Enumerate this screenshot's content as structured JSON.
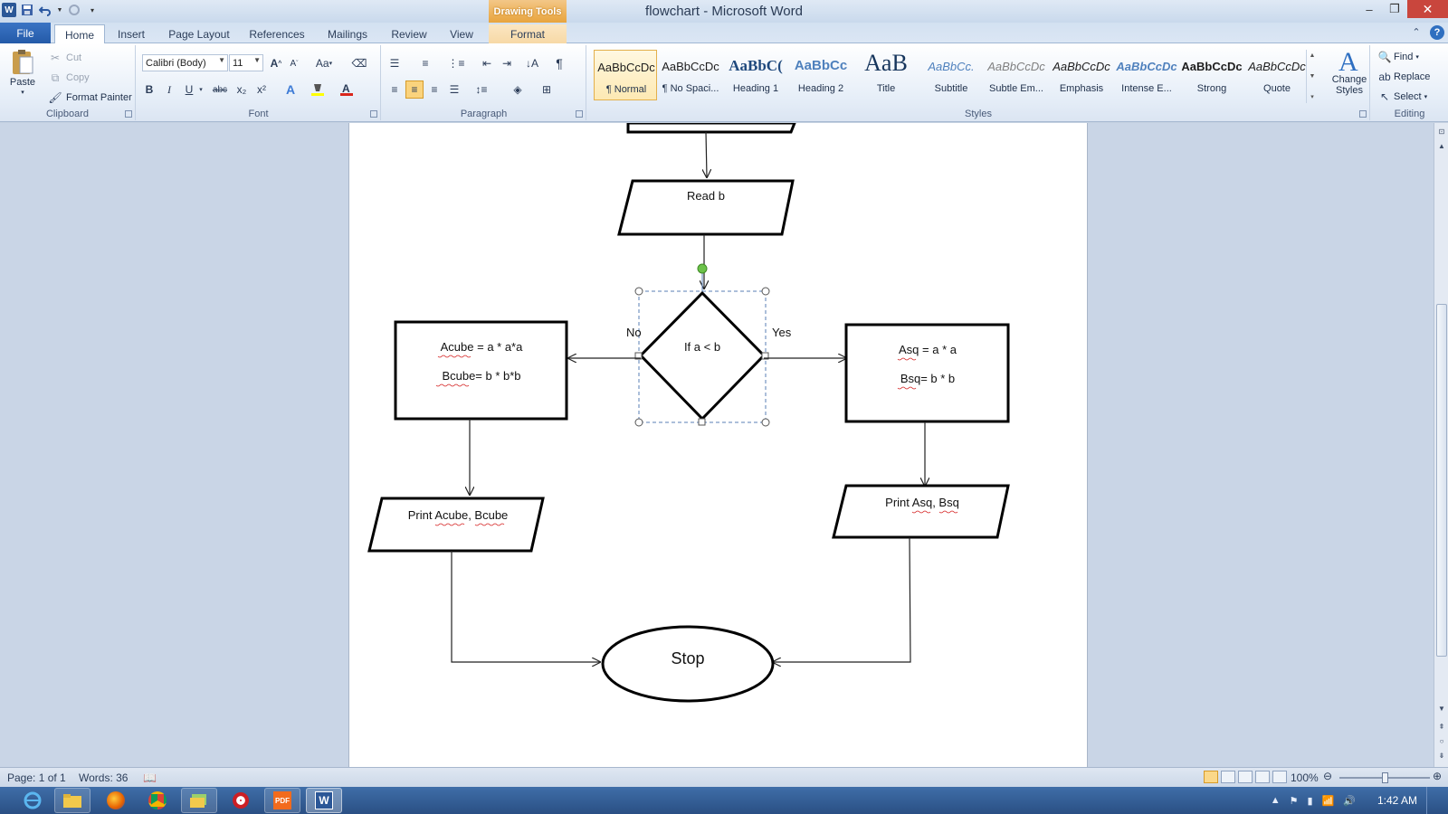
{
  "window": {
    "title": "flowchart - Microsoft Word",
    "contextual_tab_group": "Drawing Tools"
  },
  "tabs": [
    "File",
    "Home",
    "Insert",
    "Page Layout",
    "References",
    "Mailings",
    "Review",
    "View",
    "Format"
  ],
  "active_tab": "Home",
  "clipboard": {
    "label": "Clipboard",
    "paste": "Paste",
    "cut": "Cut",
    "copy": "Copy",
    "format_painter": "Format Painter"
  },
  "font": {
    "label": "Font",
    "name": "Calibri (Body)",
    "size": "11",
    "bold": "B",
    "italic": "I",
    "underline": "U",
    "strikethrough": "abc",
    "subscript": "x₂",
    "superscript": "x²",
    "grow": "A",
    "shrink": "A",
    "change_case": "Aa"
  },
  "paragraph": {
    "label": "Paragraph",
    "show_marks": "¶"
  },
  "styles": {
    "label": "Styles",
    "items": [
      {
        "sample": "AaBbCcDc",
        "name": "¶ Normal"
      },
      {
        "sample": "AaBbCcDc",
        "name": "¶ No Spaci..."
      },
      {
        "sample": "AaBbC(",
        "name": "Heading 1"
      },
      {
        "sample": "AaBbCc",
        "name": "Heading 2"
      },
      {
        "sample": "AaB",
        "name": "Title"
      },
      {
        "sample": "AaBbCc.",
        "name": "Subtitle"
      },
      {
        "sample": "AaBbCcDc",
        "name": "Subtle Em..."
      },
      {
        "sample": "AaBbCcDc",
        "name": "Emphasis"
      },
      {
        "sample": "AaBbCcDc",
        "name": "Intense E..."
      },
      {
        "sample": "AaBbCcDc",
        "name": "Strong"
      },
      {
        "sample": "AaBbCcDc",
        "name": "Quote"
      }
    ],
    "change_styles": "Change Styles"
  },
  "editing": {
    "label": "Editing",
    "find": "Find",
    "replace": "Replace",
    "select": "Select"
  },
  "flowchart": {
    "read_b": "Read b",
    "decision": "If a < b",
    "no_label": "No",
    "yes_label": "Yes",
    "left_box_line1": "Acube = a * a*a",
    "left_box_line2": "Bcube= b * b*b",
    "right_box_line1": "Asq = a * a",
    "right_box_line2": "Bsq= b * b",
    "print_left": "Print Acube, Bcube",
    "print_right": "Print Asq, Bsq",
    "stop": "Stop"
  },
  "status": {
    "page": "Page: 1 of 1",
    "words": "Words: 36",
    "zoom": "100%"
  },
  "taskbar": {
    "time": "1:42 AM"
  },
  "colors": {
    "file_tab": "#245aa8",
    "contextual_tab": "#e8a43d",
    "selection_handle": "#6cc24a"
  }
}
